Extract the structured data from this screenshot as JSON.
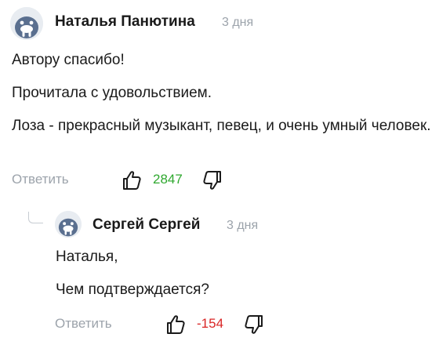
{
  "colors": {
    "positive_count": "#2fa82f",
    "negative_count": "#d92626",
    "muted_text": "#9ca3ab",
    "avatar_bg": "#e8ecf1",
    "avatar_fg": "#5a6f8f"
  },
  "icons": {
    "avatar": "walrus-avatar-icon",
    "like": "thumbs-up-icon",
    "dislike": "thumbs-down-icon"
  },
  "comments": [
    {
      "author": "Наталья Панютина",
      "time": "3 дня",
      "paragraphs": [
        "Автору спасибо!",
        "Прочитала с удовольствием.",
        "Лоза - прекрасный музыкант, певец, и очень умный человек."
      ],
      "reply_label": "Ответить",
      "rating": "2847",
      "rating_sign": "positive"
    },
    {
      "author": "Сергей Сергей",
      "time": "3 дня",
      "paragraphs": [
        "Наталья,",
        "Чем подтверждается?"
      ],
      "reply_label": "Ответить",
      "rating": "-154",
      "rating_sign": "negative"
    }
  ]
}
